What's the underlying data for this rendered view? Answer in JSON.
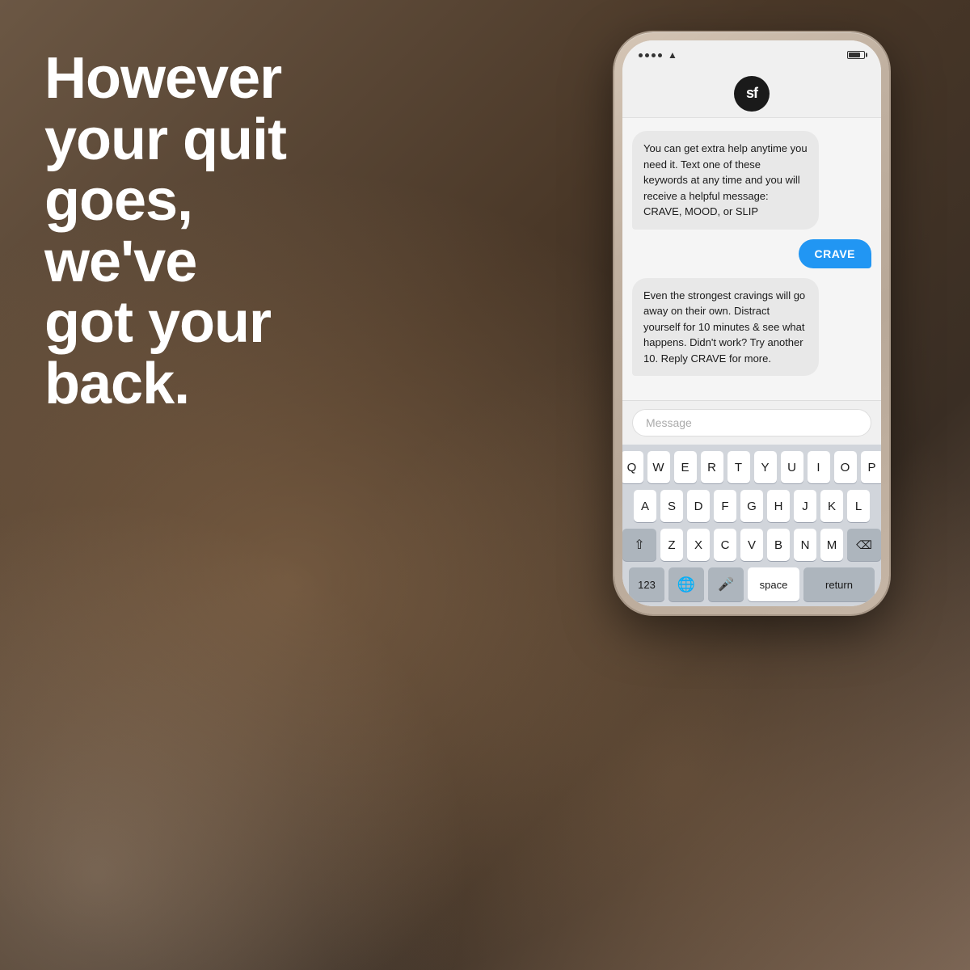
{
  "headline": {
    "line1": "However",
    "line2": "your quit",
    "line3": "goes, we've",
    "line4": "got your",
    "line5": "back.",
    "full_text": "However your quit goes, we've got your back."
  },
  "phone": {
    "status": {
      "dots": 4,
      "battery": "70"
    },
    "app_logo": "sf",
    "messages": [
      {
        "type": "incoming",
        "text": "You can get extra help anytime you need it. Text one of these keywords at any time and you will receive a helpful message: CRAVE, MOOD, or SLIP"
      },
      {
        "type": "outgoing",
        "text": "CRAVE"
      },
      {
        "type": "incoming",
        "text": "Even the strongest cravings will go away on their own. Distract yourself for 10 minutes & see what happens. Didn't work? Try another 10. Reply CRAVE for more."
      }
    ],
    "input_placeholder": "Message",
    "keyboard": {
      "row1": [
        "Q",
        "W",
        "E",
        "R",
        "T",
        "Y",
        "U",
        "I",
        "O",
        "P"
      ],
      "row2": [
        "A",
        "S",
        "D",
        "F",
        "G",
        "H",
        "J",
        "K",
        "L"
      ],
      "row3": [
        "Z",
        "X",
        "C",
        "V",
        "B",
        "N",
        "M"
      ],
      "bottom": {
        "key123": "123",
        "space_label": "space",
        "return_label": "return"
      }
    }
  },
  "colors": {
    "bubble_outgoing": "#2196F3",
    "bubble_incoming": "#e8e8e8",
    "keyboard_bg": "#d1d5db",
    "headline_color": "#ffffff",
    "bg_dark": "#4a3828"
  }
}
